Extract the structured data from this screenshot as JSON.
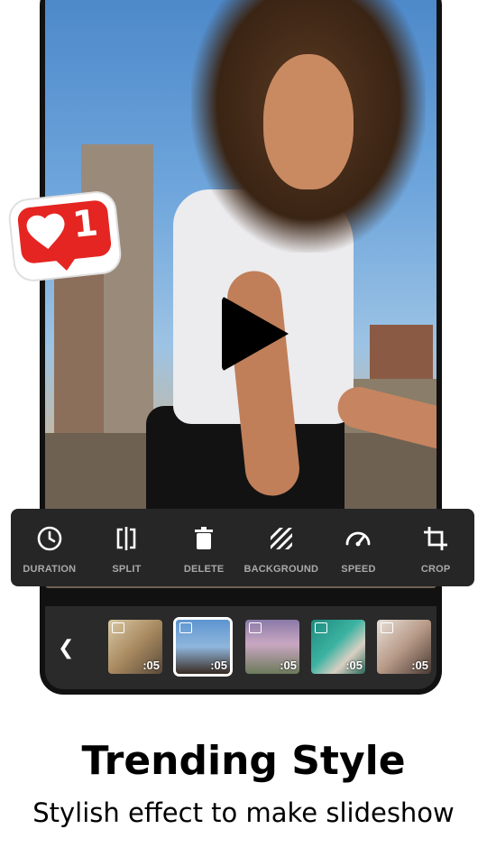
{
  "badge": {
    "count": "1"
  },
  "toolbar": {
    "items": [
      {
        "label": "DURATION",
        "icon": "clock-icon"
      },
      {
        "label": "SPLIT",
        "icon": "split-icon"
      },
      {
        "label": "DELETE",
        "icon": "trash-icon"
      },
      {
        "label": "BACKGROUND",
        "icon": "background-icon"
      },
      {
        "label": "SPEED",
        "icon": "speedometer-icon"
      },
      {
        "label": "CROP",
        "icon": "crop-icon"
      }
    ]
  },
  "timeline": {
    "back_icon": "chevron-left-icon",
    "clips": [
      {
        "duration": ":05",
        "selected": false
      },
      {
        "duration": ":05",
        "selected": true
      },
      {
        "duration": ":05",
        "selected": false
      },
      {
        "duration": ":05",
        "selected": false
      },
      {
        "duration": ":05",
        "selected": false
      }
    ]
  },
  "colors": {
    "badge_red": "#e52521",
    "toolbar_bg": "#262626",
    "label_gray": "#a9a9a9"
  },
  "headline": "Trending Style",
  "subheadline": "Stylish effect to make slideshow"
}
